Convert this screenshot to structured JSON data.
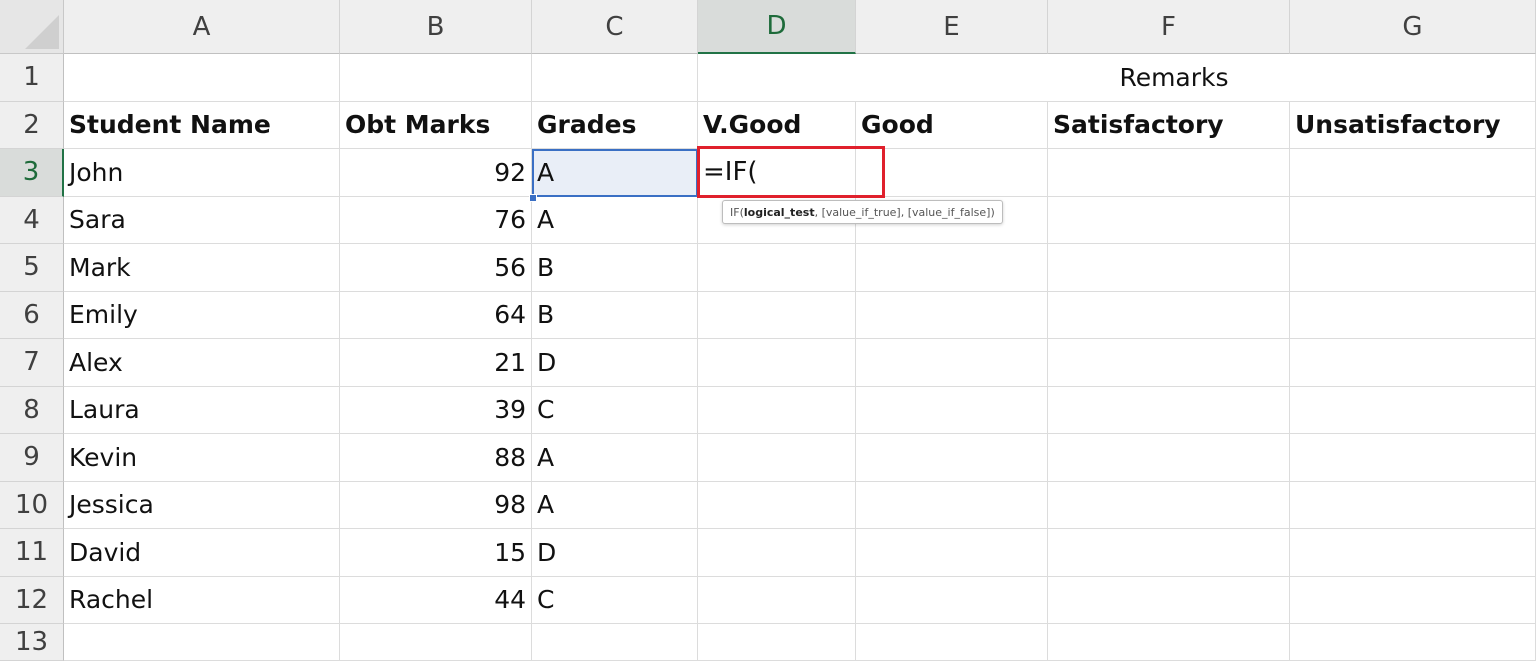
{
  "columns": [
    "A",
    "B",
    "C",
    "D",
    "E",
    "F",
    "G"
  ],
  "row_numbers": [
    "1",
    "2",
    "3",
    "4",
    "5",
    "6",
    "7",
    "8",
    "9",
    "10",
    "11",
    "12",
    "13"
  ],
  "row1": {
    "remarks": "Remarks"
  },
  "headers": {
    "student_name": "Student Name",
    "obt_marks": "Obt Marks",
    "grades": "Grades",
    "vgood": "V.Good",
    "good": "Good",
    "satisfactory": "Satisfactory",
    "unsatisfactory": "Unsatisfactory"
  },
  "students": [
    {
      "name": "John",
      "marks": "92",
      "grade": "A"
    },
    {
      "name": "Sara",
      "marks": "76",
      "grade": "A"
    },
    {
      "name": "Mark",
      "marks": "56",
      "grade": "B"
    },
    {
      "name": "Emily",
      "marks": "64",
      "grade": "B"
    },
    {
      "name": "Alex",
      "marks": "21",
      "grade": "D"
    },
    {
      "name": "Laura",
      "marks": "39",
      "grade": "C"
    },
    {
      "name": "Kevin",
      "marks": "88",
      "grade": "A"
    },
    {
      "name": "Jessica",
      "marks": "98",
      "grade": "A"
    },
    {
      "name": "David",
      "marks": "15",
      "grade": "D"
    },
    {
      "name": "Rachel",
      "marks": "44",
      "grade": "C"
    }
  ],
  "editing_formula": "=IF(",
  "tooltip": {
    "prefix": "IF(",
    "bold_arg": "logical_test",
    "rest": ", [value_if_true], [value_if_false])"
  },
  "colors": {
    "selected_header": "#217346",
    "highlight_box": "#e0202c",
    "selection_border": "#3a6fc4"
  },
  "active_cell": "D3",
  "icons": [
    "select-all-corner-icon"
  ]
}
